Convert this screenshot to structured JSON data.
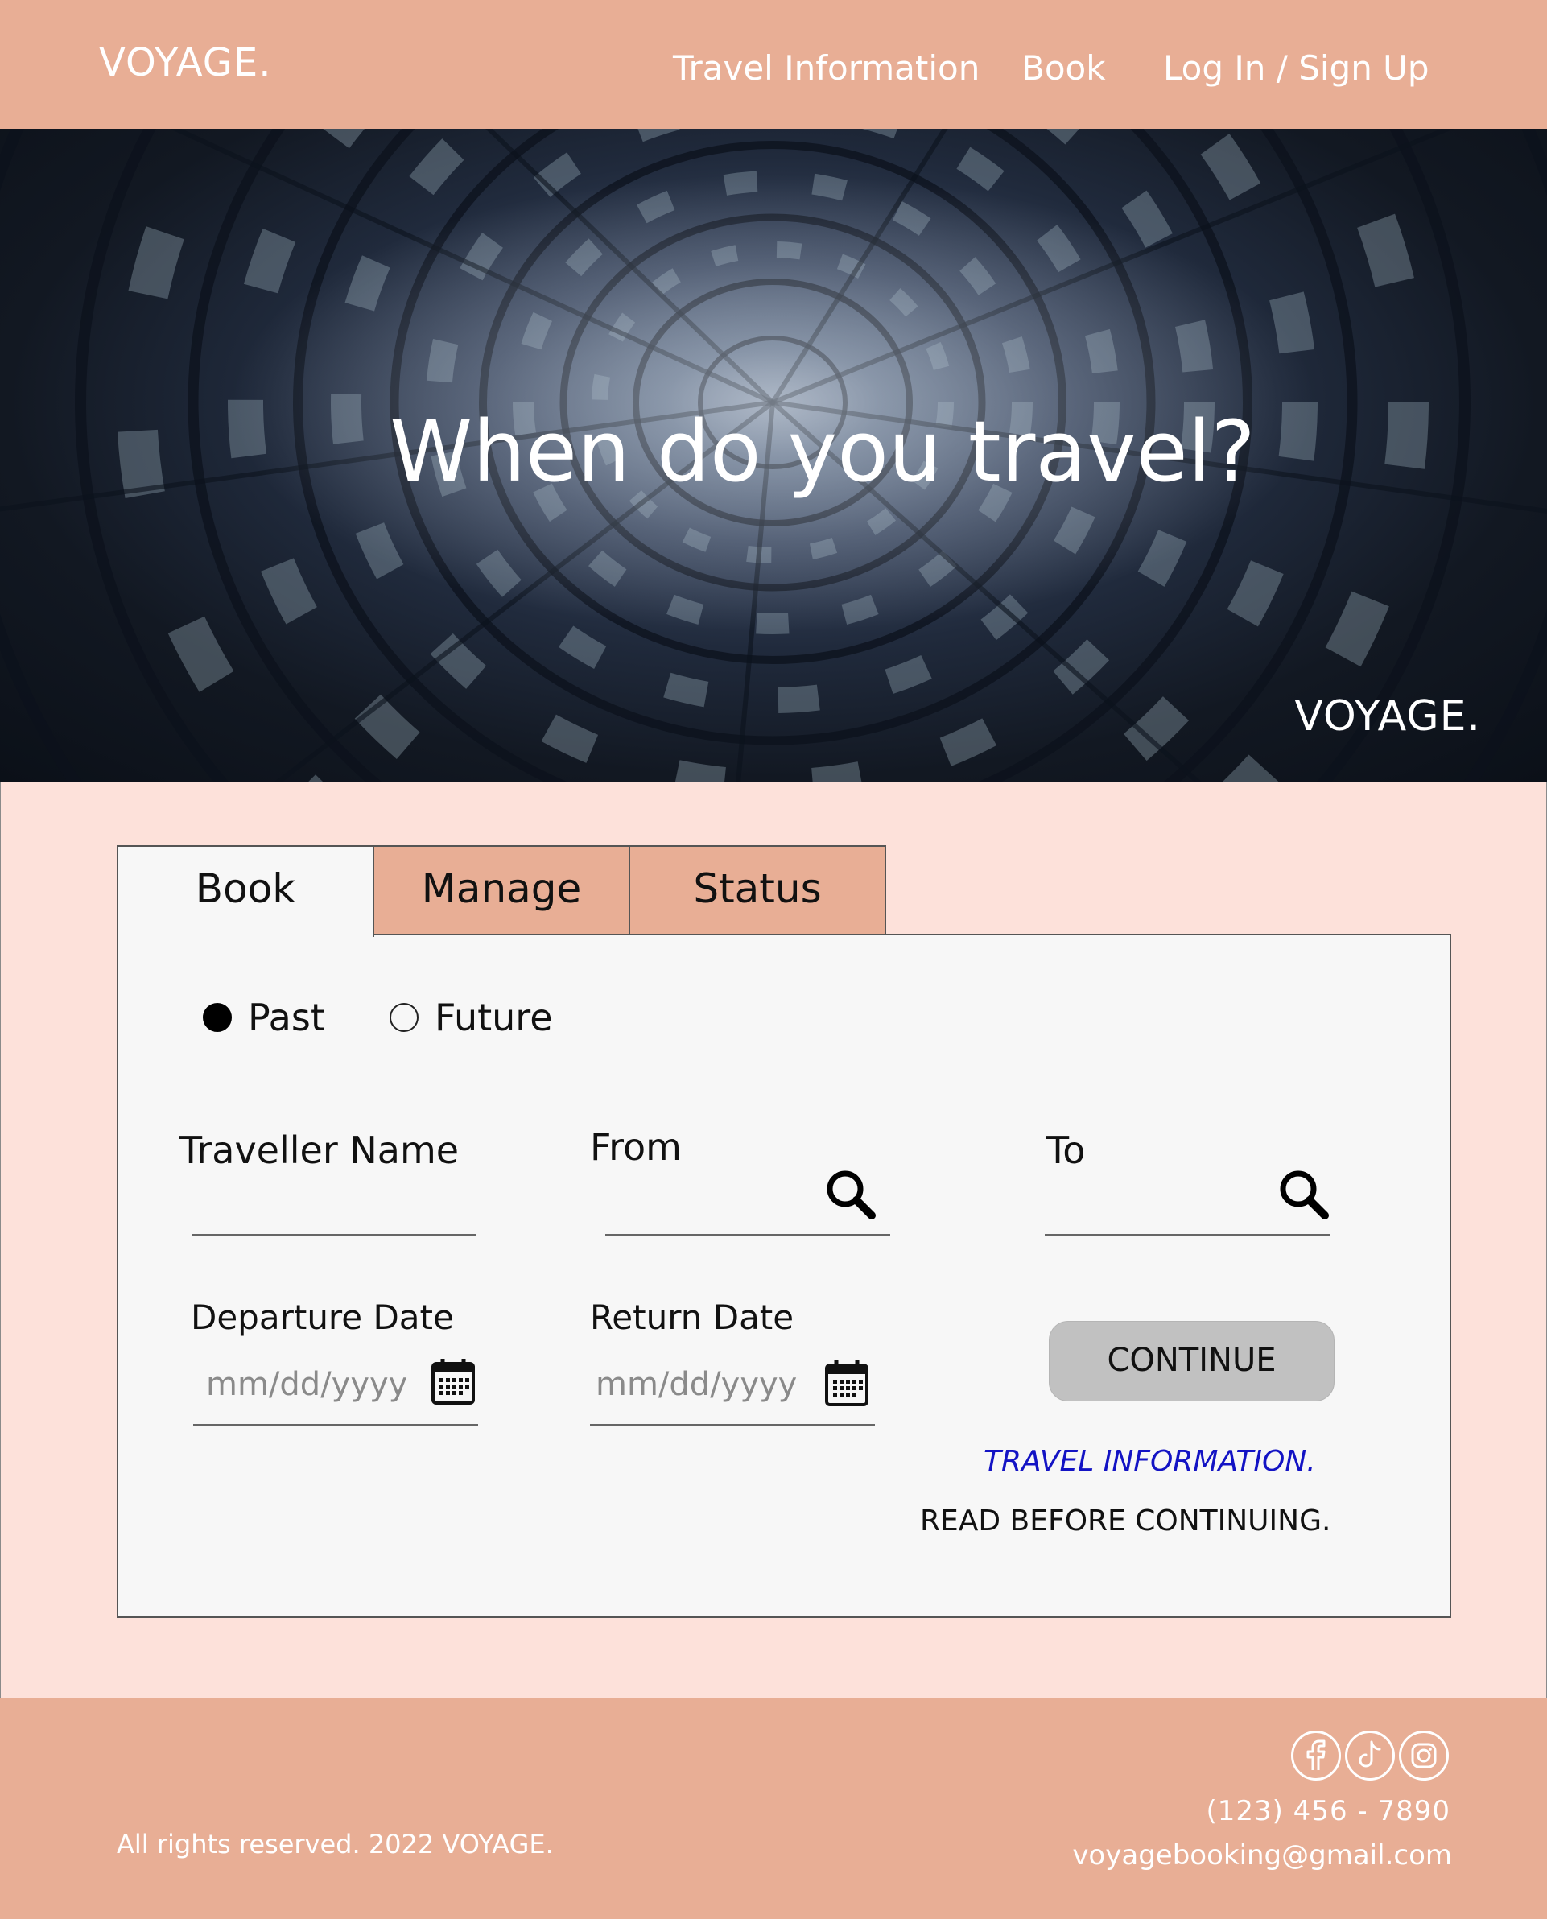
{
  "header": {
    "logo": "VOYAGE.",
    "nav": {
      "travel_information": "Travel Information",
      "book": "Book",
      "login": "Log In / Sign Up"
    }
  },
  "hero": {
    "title": "When do you travel?",
    "logo": "VOYAGE."
  },
  "tabs": [
    {
      "label": "Book",
      "active": true
    },
    {
      "label": "Manage",
      "active": false
    },
    {
      "label": "Status",
      "active": false
    }
  ],
  "form": {
    "time_filter": {
      "options": [
        "Past",
        "Future"
      ],
      "selected": "Past"
    },
    "traveller_name_label": "Traveller Name",
    "traveller_name_value": "",
    "from_label": "From",
    "from_value": "",
    "to_label": "To",
    "to_value": "",
    "departure_label": "Departure Date",
    "departure_placeholder": "mm/dd/yyyy",
    "return_label": "Return Date",
    "return_placeholder": "mm/dd/yyyy",
    "continue_label": "CONTINUE",
    "info_link": "TRAVEL INFORMATION.",
    "info_note": "READ BEFORE CONTINUING."
  },
  "footer": {
    "copyright": "All rights reserved. 2022 VOYAGE.",
    "phone": "(123) 456 - 7890",
    "email": "voyagebooking@gmail.com",
    "social_icons": [
      "facebook-icon",
      "tiktok-icon",
      "instagram-icon"
    ]
  },
  "colors": {
    "brand": "#e8ae95",
    "background": "#fde1da",
    "panel": "#f7f7f7",
    "button": "#c1c1c1",
    "link": "#1313c4"
  }
}
